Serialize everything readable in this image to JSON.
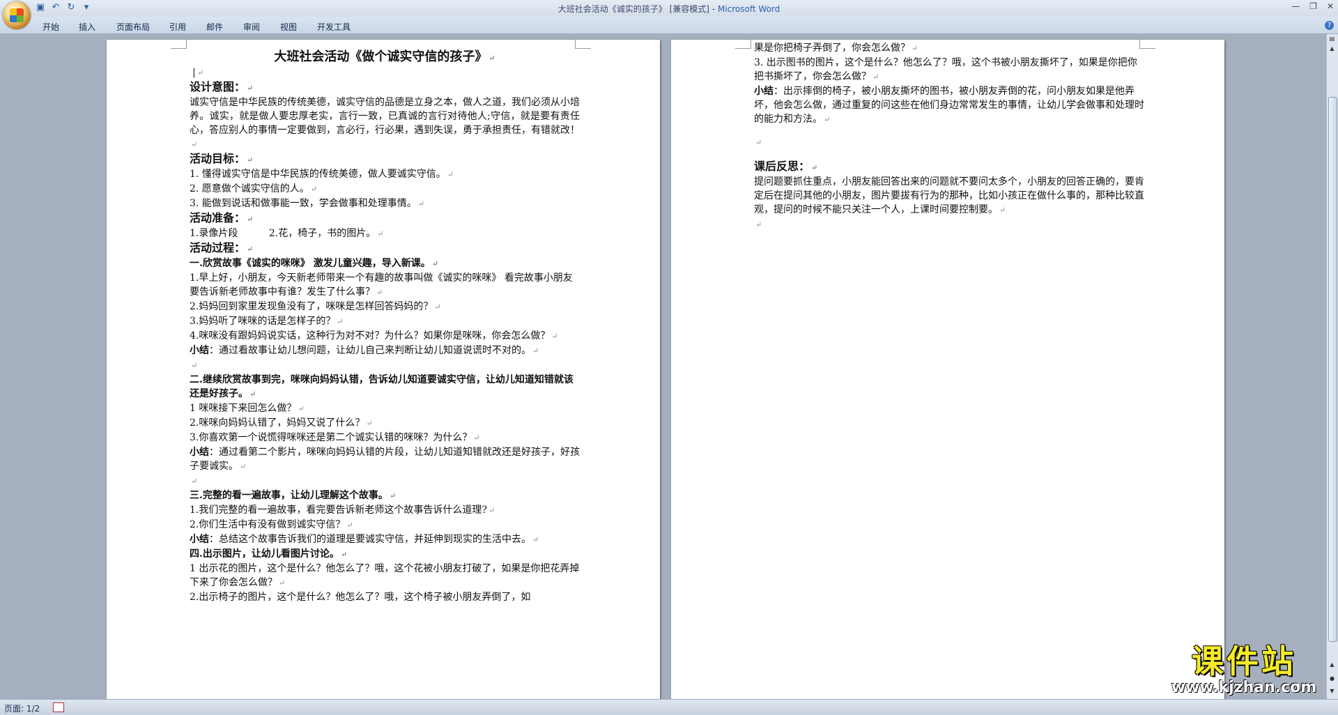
{
  "window": {
    "title": "大班社会活动《诚实的孩子》 [兼容模式] - ",
    "app_name": "Microsoft Word"
  },
  "quick_access": {
    "icons": [
      "save-icon",
      "undo-icon",
      "redo-icon",
      "customize-icon"
    ]
  },
  "ribbon": {
    "tabs": [
      "开始",
      "插入",
      "页面布局",
      "引用",
      "邮件",
      "审阅",
      "视图",
      "开发工具"
    ]
  },
  "page1": {
    "title": "大班社会活动《做个诚实守信的孩子》",
    "s1_heading": "设计意图：",
    "s1_body": "诚实守信是中华民族的传统美德，诚实守信的品德是立身之本，做人之道，我们必须从小培养。诚实，就是做人要忠厚老实，言行一致，已真诚的言行对待他人;守信，就是要有责任心，答应别人的事情一定要做到，言必行，行必果，遇到失误，勇于承担责任，有错就改！",
    "s2_heading": "活动目标：",
    "goals": [
      "1.  懂得诚实守信是中华民族的传统美德，做人要诚实守信。",
      "2.  愿意做个诚实守信的人。",
      "3.  能做到说话和做事能一致，学会做事和处理事情。"
    ],
    "s3_heading": "活动准备：",
    "prep": "1.录像片段          2.花，椅子，书的图片。",
    "s4_heading": "活动过程：",
    "part1_title": "一.欣赏故事《诚实的咪咪》 激发儿童兴趣，导入新课。",
    "part1_items": [
      "1.早上好，小朋友，今天新老师带来一个有趣的故事叫做《诚实的咪咪》 看完故事小朋友要告诉新老师故事中有谁？发生了什么事？",
      "2.妈妈回到家里发现鱼没有了，咪咪是怎样回答妈妈的？",
      "3.妈妈听了咪咪的话是怎样子的？",
      "4.咪咪没有跟妈妈说实话，这种行为对不对？为什么？如果你是咪咪，你会怎么做？"
    ],
    "part1_summary_label": "小结",
    "part1_summary": "：通过看故事让幼儿想问题，让幼儿自己来判断让幼儿知道说谎时不对的。",
    "part2_title": "二.继续欣赏故事到完，咪咪向妈妈认错，告诉幼儿知道要诚实守信，让幼儿知道知错就该还是好孩子。",
    "part2_items": [
      "1 咪咪接下来回怎么做？",
      "2.咪咪向妈妈认错了，妈妈又说了什么？",
      "3.你喜欢第一个说慌得咪咪还是第二个诚实认错的咪咪？为什么？"
    ],
    "part2_summary_label": "小结",
    "part2_summary": "：通过看第二个影片，咪咪向妈妈认错的片段，让幼儿知道知错就改还是好孩子，好孩子要诚实。",
    "part3_title": "三.完整的看一遍故事，让幼儿理解这个故事。",
    "part3_items": [
      "1.我们完整的看一遍故事，看完要告诉新老师这个故事告诉什么道理?",
      "2.你们生活中有没有做到诚实守信？"
    ],
    "part3_summary_label": "小结",
    "part3_summary": "：总结这个故事告诉我们的道理是要诚实守信，并延伸到现实的生活中去。",
    "part4_title": "四.出示图片，让幼儿看图片讨论。",
    "part4_items": [
      "1 出示花的图片，这个是什么？他怎么了？哦，这个花被小朋友打破了，如果是你把花弄掉下来了你会怎么做？",
      "2.出示椅子的图片，这个是什么？他怎么了？哦，这个椅子被小朋友弄倒了，如"
    ]
  },
  "page2": {
    "lines": [
      "果是你把椅子弄倒了，你会怎么做？",
      "3. 出示图书的图片，这个是什么？他怎么了？哦，这个书被小朋友撕坏了，如果是你把你把书撕坏了，你会怎么做？"
    ],
    "summary_label": "小结",
    "summary": "：出示摔倒的椅子，被小朋友撕坏的图书，被小朋友弄倒的花，问小朋友如果是他弄坏，他会怎么做，通过重复的问这些在他们身边常常发生的事情，让幼儿学会做事和处理时的能力和方法。",
    "reflection_heading": "课后反思：",
    "reflection_body": "提问题要抓住重点，小朋友能回答出来的问题就不要问太多个，小朋友的回答正确的，要肯定后在提问其他的小朋友，图片要拔有行为的那种，比如小孩正在做什么事的，那种比较直观，提问的时候不能只关注一个人，上课时间要控制要。"
  },
  "status": {
    "page": "页面: 1/2"
  },
  "watermark": {
    "cn": "课件站",
    "url": "www.kjzhan.com"
  }
}
